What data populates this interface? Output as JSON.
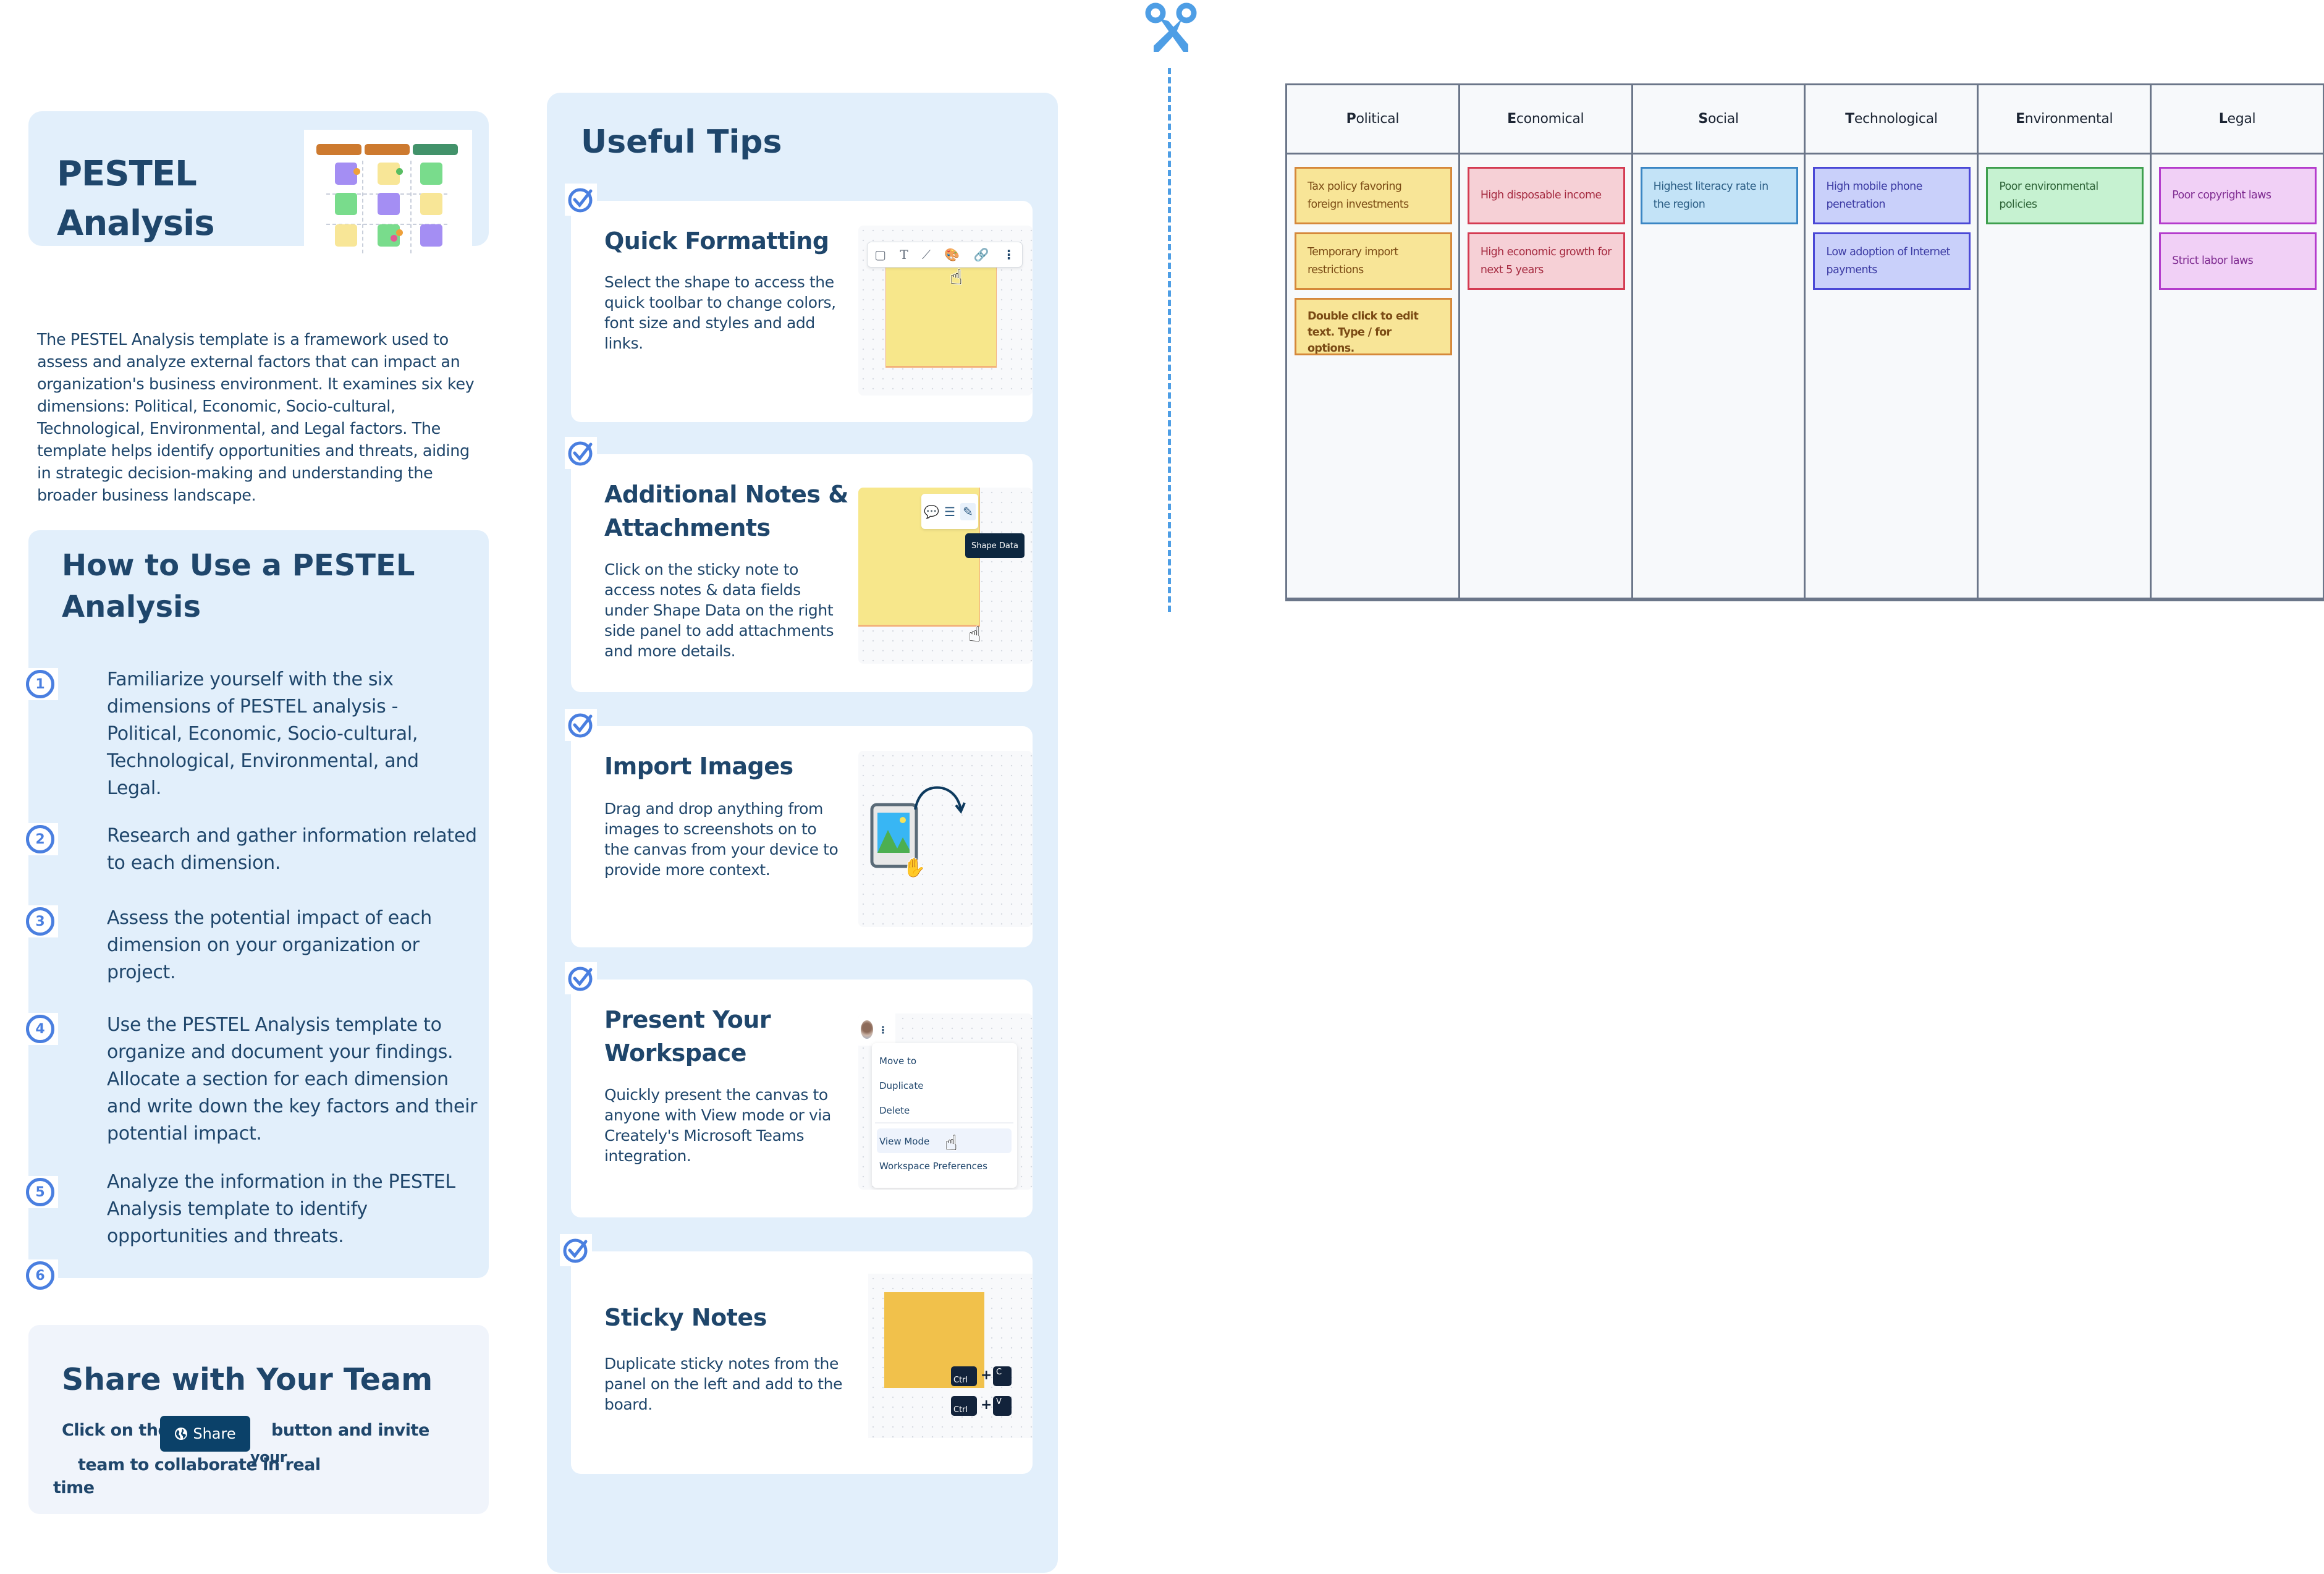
{
  "colors": {
    "heading": "#1f466b",
    "panel_bg": "#e2effb",
    "accent_blue": "#4a7fe0",
    "scissors": "#4e9ee5",
    "share_button_bg": "#0b4169"
  },
  "header": {
    "title_line1": "PESTEL",
    "title_line2": "Analysis",
    "thumbnail_icon": "pestel-board-thumbnail"
  },
  "description": "The PESTEL Analysis template is a framework used to assess and analyze external factors that can impact an organization's business environment. It examines six key dimensions: Political, Economic, Socio-cultural, Technological, Environmental, and Legal factors. The template helps identify opportunities and threats, aiding in strategic decision-making and understanding the broader business landscape.",
  "how_to": {
    "title_line1": "How to Use a PESTEL",
    "title_line2": "Analysis",
    "steps": [
      {
        "num": "1",
        "text": "Familiarize yourself with the six dimensions of PESTEL analysis - Political, Economic, Socio-cultural, Technological, Environmental, and Legal."
      },
      {
        "num": "2",
        "text": "Research and gather information related to each dimension."
      },
      {
        "num": "3",
        "text": "Assess the potential impact of each dimension on your organization or project."
      },
      {
        "num": "4",
        "text": "Use the PESTEL Analysis template to organize and document your findings. Allocate a section for each dimension and write down the key factors and their potential impact."
      },
      {
        "num": "5",
        "text": "Analyze the information in the PESTEL Analysis template to identify opportunities and threats."
      },
      {
        "num": "6",
        "text": ""
      }
    ]
  },
  "share": {
    "title": "Share with Your Team",
    "text_before": "Click on the",
    "button_label": "Share",
    "text_after": "button and invite",
    "text_your": "your",
    "text_line2": "team to collaborate in real",
    "text_line3": "time"
  },
  "tips": {
    "title": "Useful Tips",
    "cards": [
      {
        "title": "Quick Formatting",
        "text": "Select the shape to access the quick toolbar to change colors, font size and styles and add links."
      },
      {
        "title": "Additional Notes & Attachments",
        "text": "Click on the sticky note to access notes & data fields under Shape Data on the right side panel to add attachments and more details.",
        "tooltip": "Shape Data"
      },
      {
        "title": "Import Images",
        "text": "Drag and drop anything from images to screenshots on to the canvas from your device to provide more context."
      },
      {
        "title": "Present Your Workspace",
        "text": "Quickly present the canvas to anyone with View mode or via Creately's Microsoft Teams integration.",
        "menu": [
          "Move to",
          "Duplicate",
          "Delete",
          "View Mode",
          "Workspace Preferences"
        ]
      },
      {
        "title": "Sticky Notes",
        "text": "Duplicate sticky notes from the panel on the left and add to the board.",
        "keys": {
          "ctrl": "Ctrl",
          "copy": "C",
          "paste": "V",
          "plus": "+"
        }
      }
    ]
  },
  "pestel": {
    "columns": [
      {
        "initial": "P",
        "rest": "olitical",
        "notes": [
          {
            "text": "Tax policy favoring foreign investments",
            "bg": "#f8e597",
            "border": "#d5883a",
            "color": "#7a4a14"
          },
          {
            "text": "Temporary import restrictions",
            "bg": "#f8e597",
            "border": "#d5883a",
            "color": "#7a4a14"
          },
          {
            "text": "Double click to edit text. Type / for options.",
            "bg": "#f8e597",
            "border": "#d5883a",
            "color": "#7a4a14",
            "bold": true
          }
        ]
      },
      {
        "initial": "E",
        "rest": "conomical",
        "notes": [
          {
            "text": "High disposable income",
            "bg": "#f6d0d6",
            "border": "#d43b52",
            "color": "#a52a40"
          },
          {
            "text": "High economic growth for next 5 years",
            "bg": "#f6d0d6",
            "border": "#d43b52",
            "color": "#a52a40"
          }
        ]
      },
      {
        "initial": "S",
        "rest": "ocial",
        "notes": [
          {
            "text": "Highest literacy rate in the region",
            "bg": "#c3e3f7",
            "border": "#3a86c4",
            "color": "#2a5d84"
          }
        ]
      },
      {
        "initial": "T",
        "rest": "echnological",
        "notes": [
          {
            "text": "High mobile phone penetration",
            "bg": "#c9d0fa",
            "border": "#4a48d6",
            "color": "#3b3aa3"
          },
          {
            "text": "Low adoption of Internet payments",
            "bg": "#c9d0fa",
            "border": "#4a48d6",
            "color": "#3b3aa3"
          }
        ]
      },
      {
        "initial": "E",
        "rest": "nvironmental",
        "notes": [
          {
            "text": "Poor environmental policies",
            "bg": "#c6f2d1",
            "border": "#3e9f4e",
            "color": "#2c6236"
          }
        ]
      },
      {
        "initial": "L",
        "rest": "egal",
        "notes": [
          {
            "text": "Poor copyright laws",
            "bg": "#f1d0f6",
            "border": "#b43ccc",
            "color": "#7f2c91"
          },
          {
            "text": "Strict labor laws",
            "bg": "#f1d0f6",
            "border": "#b43ccc",
            "color": "#7f2c91"
          }
        ]
      }
    ]
  }
}
